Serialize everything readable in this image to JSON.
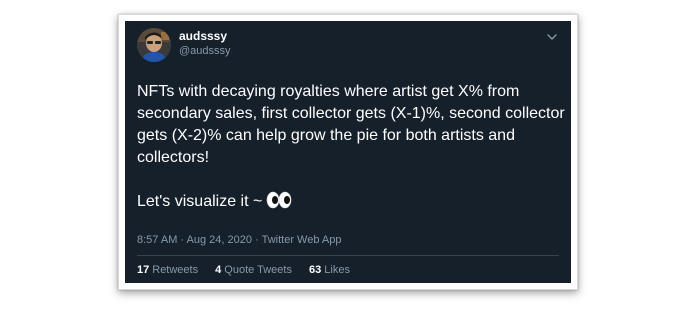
{
  "user": {
    "display_name": "audsssy",
    "handle": "@audsssy"
  },
  "tweet": {
    "text": "NFTs with decaying royalties where artist get X% from secondary sales, first collector gets (X-1)%, second collector gets (X-2)% can help grow the pie for both artists and collectors!",
    "text2": "Let's visualize it ~",
    "emoji_icon": "eyes-emoji-icon",
    "time": "8:57 AM",
    "separator": "·",
    "date": "Aug 24, 2020",
    "source": "Twitter Web App"
  },
  "stats": {
    "retweets_count": "17",
    "retweets_label": "Retweets",
    "quotes_count": "4",
    "quotes_label": "Quote Tweets",
    "likes_count": "63",
    "likes_label": "Likes"
  },
  "colors": {
    "background": "#15202b",
    "text": "#ffffff",
    "secondary": "#8899a6",
    "divider": "#38444d"
  }
}
